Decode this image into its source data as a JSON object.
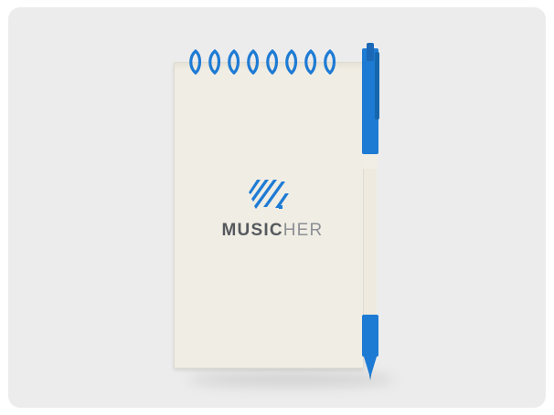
{
  "product": {
    "brand_strong": "MUSIC",
    "brand_light": "HER",
    "logo_icon": "musicher-logo-mark"
  },
  "colors": {
    "background": "#ececec",
    "paper": "#f0ede4",
    "accent": "#1e7bd4",
    "text": "#55595e"
  }
}
